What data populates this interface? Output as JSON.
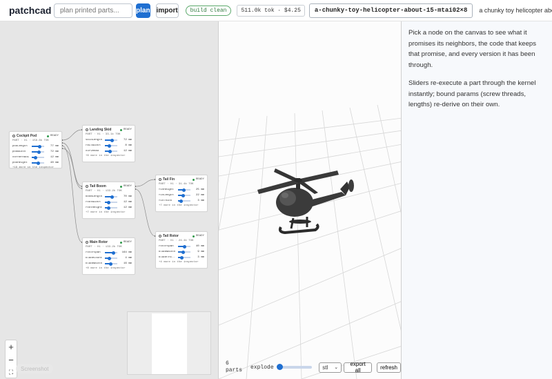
{
  "topbar": {
    "logo_text": "patchcad",
    "search_placeholder": "plan printed parts...",
    "plan_label": "plan",
    "import_label": "import",
    "build_status": "build clean",
    "token_usage": "511.0k tok · $4.25",
    "slug": "a-chunky-toy-helicopter-about-15-mtai02×8",
    "title": "a chunky toy helicopter abou..."
  },
  "nodes": [
    {
      "title": "Cockpit Pod",
      "status": "READY",
      "meta": "PART · V1 · 158.6k TOK",
      "params": [
        {
          "name": "podLength",
          "value": "77 mm",
          "fill": 0.65
        },
        {
          "name": "podWidth",
          "value": "72 mm",
          "fill": 0.6
        },
        {
          "name": "cornerRadi",
          "value": "12 mm",
          "fill": 0.3
        },
        {
          "name": "podHeight",
          "value": "48 mm",
          "fill": 0.5
        }
      ],
      "more": "+18 more in the inspector"
    },
    {
      "title": "Landing Skid",
      "status": "READY",
      "meta": "PART · V1 · 33.1k TOK",
      "params": [
        {
          "name": "skidLength",
          "value": "72 mm",
          "fill": 0.6
        },
        {
          "name": "railWidth",
          "value": "8 mm",
          "fill": 0.35
        },
        {
          "name": "curveRad",
          "value": "12 mm",
          "fill": 0.4
        }
      ],
      "more": "+6 more in the inspector"
    },
    {
      "title": "Tail Boom",
      "status": "READY",
      "meta": "PART · V1 · 133.2k TOK",
      "params": [
        {
          "name": "boomLength",
          "value": "70 mm",
          "fill": 0.6
        },
        {
          "name": "rootWidth",
          "value": "12 mm",
          "fill": 0.3
        },
        {
          "name": "rootHeight",
          "value": "12 mm",
          "fill": 0.3
        }
      ],
      "more": "+7 more in the inspector"
    },
    {
      "title": "Tail Fin",
      "status": "READY",
      "meta": "PART · V1 · 31.4k TOK",
      "params": [
        {
          "name": "finHeight",
          "value": "25 mm",
          "fill": 0.45
        },
        {
          "name": "finLength",
          "value": "22 mm",
          "fill": 0.4
        },
        {
          "name": "finThick",
          "value": "3 mm",
          "fill": 0.25
        }
      ],
      "more": "+7 more in the inspector"
    },
    {
      "title": "Main Rotor",
      "status": "READY",
      "meta": "PART · V1 · 133.2k TOK",
      "params": [
        {
          "name": "rotorSpan",
          "value": "164 mm",
          "fill": 0.7
        },
        {
          "name": "bladeCount",
          "value": "4 mm",
          "fill": 0.35
        },
        {
          "name": "bladeWidth",
          "value": "16 mm",
          "fill": 0.45
        }
      ],
      "more": "+8 more in the inspector"
    },
    {
      "title": "Tail Rotor",
      "status": "READY",
      "meta": "PART · V1 · 24.4k TOK",
      "params": [
        {
          "name": "rotorSpan",
          "value": "40 mm",
          "fill": 0.5
        },
        {
          "name": "bladeWidth",
          "value": "9 mm",
          "fill": 0.4
        },
        {
          "name": "bladeThi..",
          "value": "3 mm",
          "fill": 0.3
        }
      ],
      "more": "+4 more in the inspector"
    }
  ],
  "canvas": {
    "zoom_in": "+",
    "zoom_out": "−",
    "fit": "⛶",
    "screenshot_label": "Screenshot"
  },
  "viewport": {
    "parts_count": "6",
    "parts_label": "parts",
    "explode_label": "explode",
    "explode_value": 0,
    "format_selected": "stl",
    "export_label": "export all",
    "refresh_label": "refresh"
  },
  "inspector": {
    "intro": "Pick a node on the canvas to see what it promises its neighbors, the code that keeps that promise, and every version it has been through.",
    "hint": "Sliders re-execute a part through the kernel instantly; bound params (screw threads, lengths) re-derive on their own."
  }
}
